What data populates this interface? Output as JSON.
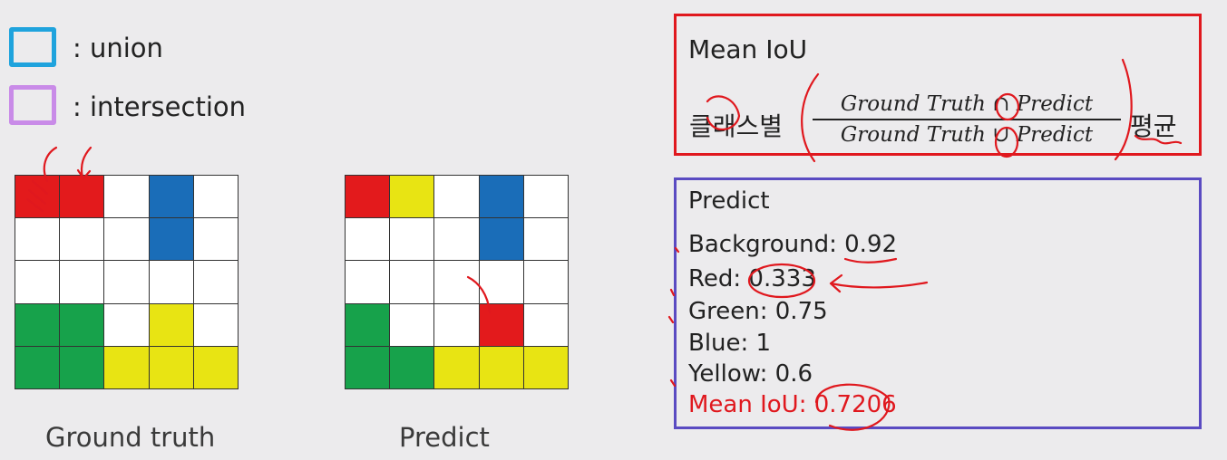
{
  "legend": [
    {
      "label": ": union",
      "color": "#1fa3dd"
    },
    {
      "label": ": intersection",
      "color": "#c98be8"
    }
  ],
  "colors": {
    "R": "#e31a1c",
    "G": "#17a24b",
    "B": "#1a6db8",
    "Y": "#e8e413",
    "W": "#ffffff"
  },
  "ground_truth": {
    "caption": "Ground truth",
    "cells": [
      [
        "R",
        "R",
        "W",
        "B",
        "W"
      ],
      [
        "W",
        "W",
        "W",
        "B",
        "W"
      ],
      [
        "W",
        "W",
        "W",
        "W",
        "W"
      ],
      [
        "G",
        "G",
        "W",
        "Y",
        "W"
      ],
      [
        "G",
        "G",
        "Y",
        "Y",
        "Y"
      ]
    ]
  },
  "predict": {
    "caption": "Predict",
    "cells": [
      [
        "R",
        "Y",
        "W",
        "B",
        "W"
      ],
      [
        "W",
        "W",
        "W",
        "B",
        "W"
      ],
      [
        "W",
        "W",
        "W",
        "W",
        "W"
      ],
      [
        "G",
        "W",
        "W",
        "R",
        "W"
      ],
      [
        "G",
        "G",
        "Y",
        "Y",
        "Y"
      ]
    ]
  },
  "formula": {
    "title": "Mean IoU",
    "prefix": "클래스별",
    "numerator": "Ground Truth ∩ Predict",
    "denominator": "Ground Truth ∪ Predict",
    "suffix": "평균"
  },
  "results": {
    "title": "Predict",
    "lines": [
      {
        "label": "Background: 0.92",
        "highlight": false
      },
      {
        "label": "Red: 0.333",
        "highlight": false
      },
      {
        "label": "Green: 0.75",
        "highlight": false
      },
      {
        "label": "Blue: 1",
        "highlight": false
      },
      {
        "label": "Yellow: 0.6",
        "highlight": false
      },
      {
        "label": "Mean IoU: 0.7206",
        "highlight": true
      }
    ]
  }
}
